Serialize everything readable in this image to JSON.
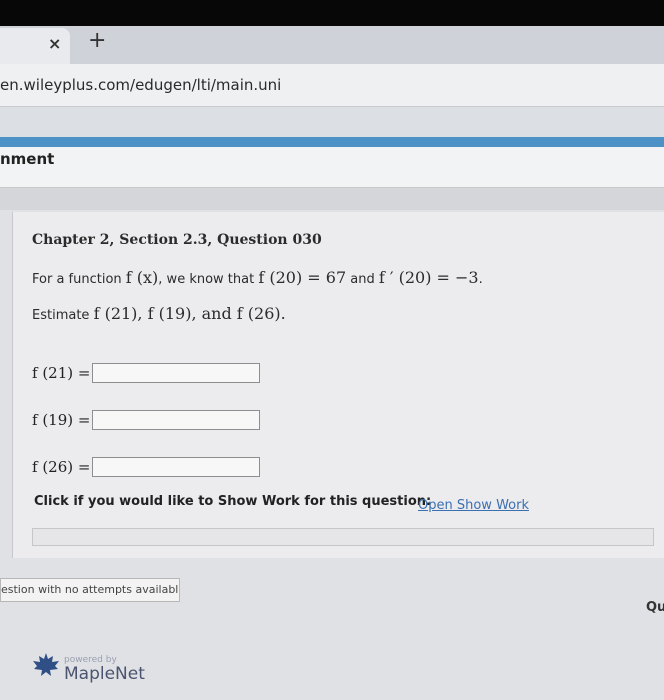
{
  "browser": {
    "tab_close": "×",
    "new_tab": "+",
    "url": "en.wileyplus.com/edugen/lti/main.uni"
  },
  "assignment": {
    "title": "nment"
  },
  "question": {
    "title": "Chapter 2, Section 2.3, Question 030",
    "intro_prefix": "For a function ",
    "intro_func": "f (x)",
    "intro_mid": ", we know that ",
    "intro_eq1": "f (20) = 67",
    "intro_and": " and ",
    "intro_eq2": "f ′ (20) = −3",
    "intro_end": ".",
    "estimate_prefix": "Estimate ",
    "estimate_terms": "f (21), f (19), and f (26).",
    "answers": [
      {
        "label": "f (21) =",
        "value": ""
      },
      {
        "label": "f (19) =",
        "value": ""
      },
      {
        "label": "f (26) =",
        "value": ""
      }
    ],
    "show_work_text": "Click if you would like to Show Work for this question:",
    "show_work_link": "Open Show Work"
  },
  "footer": {
    "attempts": "estion with no attempts available.",
    "qu": "Qu",
    "powered_by": "powered by",
    "brand": "MapleNet"
  }
}
